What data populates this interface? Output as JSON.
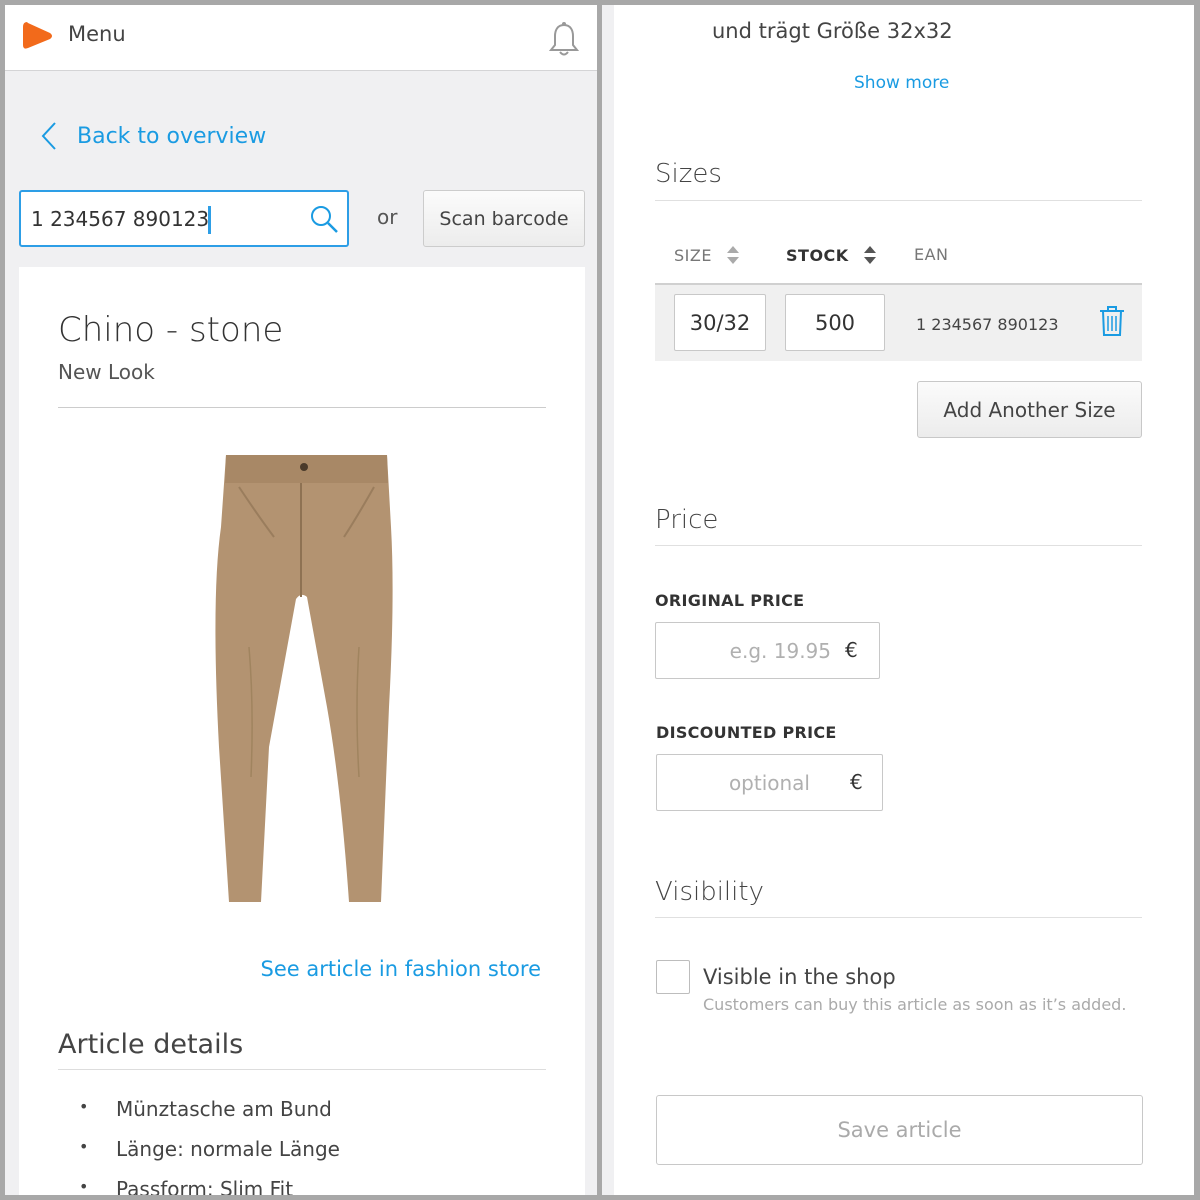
{
  "header": {
    "menu_label": "Menu"
  },
  "nav": {
    "back_label": "Back to overview"
  },
  "search": {
    "value": "1 234567 890123",
    "or_label": "or",
    "scan_label": "Scan barcode"
  },
  "product": {
    "title": "Chino - stone",
    "brand": "New Look",
    "store_link": "See article in fashion store",
    "details_title": "Article details",
    "details": [
      "Münztasche am Bund",
      "Länge: normale Länge",
      "Passform: Slim Fit"
    ]
  },
  "description": {
    "tail_text": "und trägt Größe 32x32",
    "show_more": "Show more"
  },
  "sizes": {
    "title": "Sizes",
    "columns": {
      "size": "SIZE",
      "stock": "STOCK",
      "ean": "EAN"
    },
    "rows": [
      {
        "size": "30/32",
        "stock": "500",
        "ean": "1 234567 890123"
      }
    ],
    "add_label": "Add Another Size"
  },
  "price": {
    "title": "Price",
    "original_label": "ORIGINAL PRICE",
    "original_placeholder": "e.g. 19.95",
    "discount_label": "DISCOUNTED PRICE",
    "discount_placeholder": "optional",
    "currency": "€"
  },
  "visibility": {
    "title": "Visibility",
    "checkbox_label": "Visible in the shop",
    "checkbox_hint": "Customers can buy this article as soon as it’s added."
  },
  "actions": {
    "save_label": "Save article"
  },
  "colors": {
    "accent": "#1a9be2",
    "logo": "#f26a1b",
    "pants": "#b39371"
  }
}
